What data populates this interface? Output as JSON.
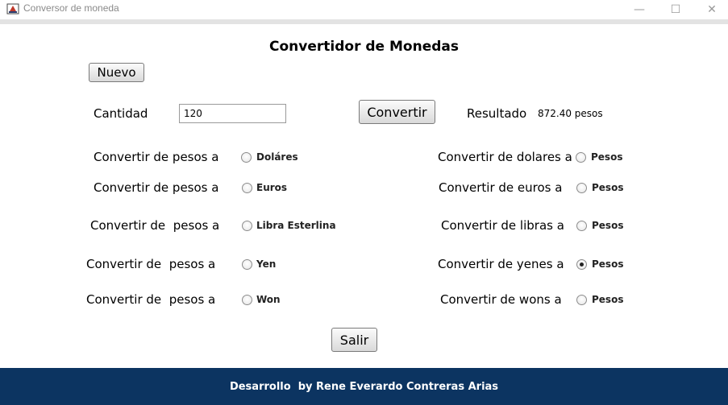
{
  "window": {
    "title": "Conversor de moneda",
    "minimize_glyph": "—",
    "maximize_glyph": "☐",
    "close_glyph": "✕"
  },
  "main": {
    "heading": "Convertidor de Monedas",
    "nuevo_label": "Nuevo",
    "cantidad_label": "Cantidad",
    "cantidad_value": "120",
    "convertir_label": "Convertir",
    "resultado_label": "Resultado",
    "resultado_value": "872.40 pesos",
    "salir_label": "Salir"
  },
  "left_options": [
    {
      "label": "Convertir de pesos a",
      "option": "Doláres",
      "checked": false
    },
    {
      "label": "Convertir de pesos a",
      "option": "Euros",
      "checked": false
    },
    {
      "label": "Convertir de  pesos a",
      "option": "Libra Esterlina",
      "checked": false
    },
    {
      "label": "Convertir de  pesos a",
      "option": "Yen",
      "checked": false
    },
    {
      "label": "Convertir de  pesos a",
      "option": "Won",
      "checked": false
    }
  ],
  "right_options": [
    {
      "label": "Convertir de dolares a",
      "option": "Pesos",
      "checked": false
    },
    {
      "label": "Convertir de euros a",
      "option": "Pesos",
      "checked": false
    },
    {
      "label": "Convertir de libras a",
      "option": "Pesos",
      "checked": false
    },
    {
      "label": "Convertir de yenes a",
      "option": "Pesos",
      "checked": true
    },
    {
      "label": "Convertir de wons a",
      "option": "Pesos",
      "checked": false
    }
  ],
  "footer": {
    "credit": "Desarrollo  by Rene Everardo Contreras Arias"
  },
  "colors": {
    "footer_bg": "#0c3461"
  }
}
